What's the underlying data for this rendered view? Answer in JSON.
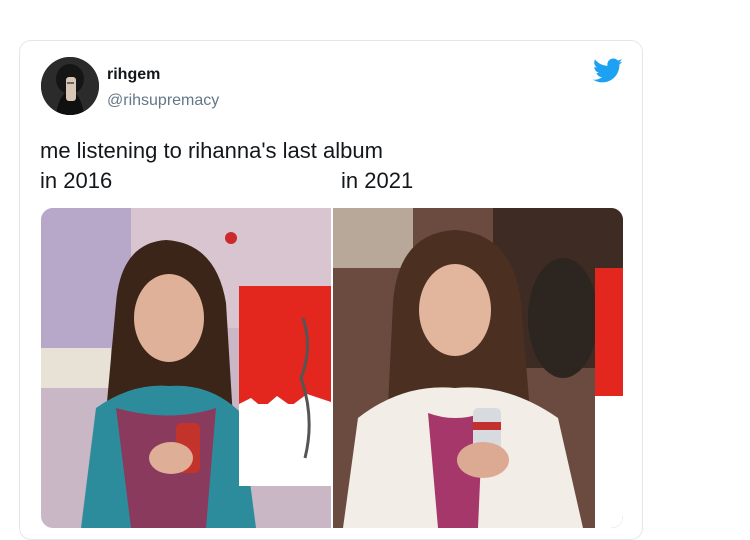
{
  "tweet": {
    "display_name": "rihgem",
    "handle": "@rihsupremacy",
    "text_line1": "me listening to rihanna's last album",
    "text_left": "in 2016",
    "text_right": "in 2021"
  },
  "icons": {
    "brand": "twitter-bird-icon",
    "brand_color": "#1da1f2"
  },
  "media": {
    "panels": [
      {
        "id": "2016",
        "image": "girl-holding-soda-can-with-red-white-album-cover"
      },
      {
        "id": "2021",
        "image": "woman-holding-soda-can-with-partial-red-white-album-cover"
      }
    ]
  }
}
